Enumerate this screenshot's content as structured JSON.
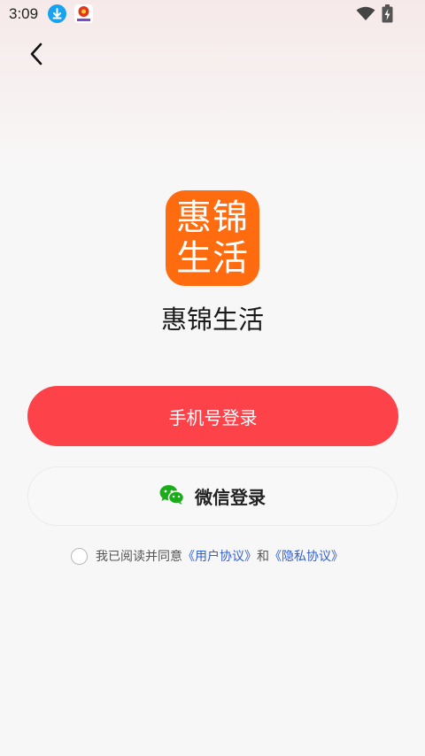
{
  "status_bar": {
    "time": "3:09",
    "icons": [
      "download-icon",
      "app-notification-icon",
      "wifi-icon",
      "battery-charging-icon"
    ]
  },
  "header": {
    "back_icon": "chevron-left-icon"
  },
  "app": {
    "logo_line1": "惠锦",
    "logo_line2": "生活",
    "name": "惠锦生活",
    "brand_color": "#ff6b0f"
  },
  "login": {
    "phone_button_label": "手机号登录",
    "phone_button_color": "#fd424a",
    "wechat_button_label": "微信登录",
    "wechat_icon": "wechat-icon"
  },
  "agreement": {
    "prefix": "我已阅读并同意",
    "user_agreement": "《用户协议》",
    "conjunction": "和",
    "privacy_policy": "《隐私协议》",
    "link_color": "#2f5fd6"
  }
}
